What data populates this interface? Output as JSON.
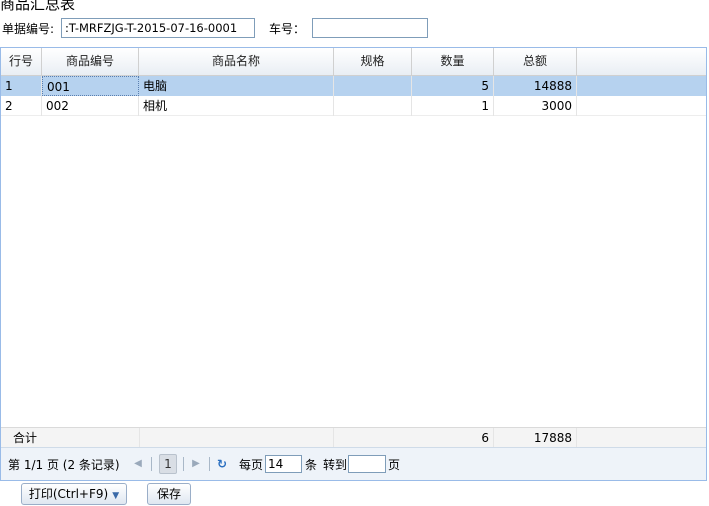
{
  "page": {
    "title": "商品汇总表"
  },
  "form": {
    "doc_no_label": "单据编号:",
    "doc_no_value": ":T-MRFZJG-T-2015-07-16-0001",
    "car_no_label": "车号：",
    "car_no_value": ""
  },
  "grid": {
    "columns": [
      "行号",
      "商品编号",
      "商品名称",
      "规格",
      "数量",
      "总额"
    ],
    "rows": [
      {
        "line": "1",
        "code": "001",
        "name": "电脑",
        "spec": "",
        "qty": "5",
        "total": "14888"
      },
      {
        "line": "2",
        "code": "002",
        "name": "相机",
        "spec": "",
        "qty": "1",
        "total": "3000"
      }
    ],
    "footer": {
      "label": "合计",
      "qty": "6",
      "total": "17888"
    }
  },
  "pager": {
    "summary": "第 1/1 页 (2 条记录)",
    "current_page": "1",
    "per_page_label": "每页",
    "per_page_value": "14",
    "per_page_unit": "条",
    "goto_label": "转到",
    "goto_value": "",
    "page_unit": "页"
  },
  "actions": {
    "print_label": "打印(Ctrl+F9)",
    "save_label": "保存"
  },
  "icons": {
    "first": "first-page-icon",
    "prev": "prev-page-icon",
    "next": "next-page-icon",
    "refresh": "refresh-icon",
    "dropdown": "chevron-down-icon"
  },
  "colors": {
    "selected_row": "#b6d2ef",
    "grid_border": "#99bbe8",
    "pager_bg": "#eef3f9"
  }
}
